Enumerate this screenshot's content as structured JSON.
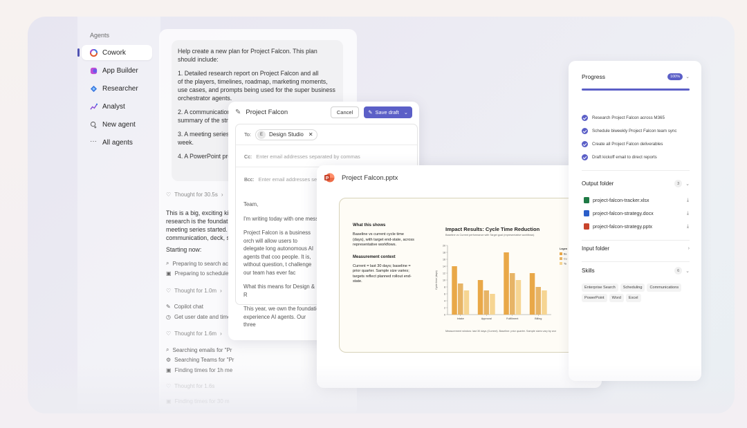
{
  "sidebar": {
    "title": "Agents",
    "items": [
      {
        "label": "Cowork",
        "icon": "copilot-icon"
      },
      {
        "label": "App Builder",
        "icon": "app-builder-icon"
      },
      {
        "label": "Researcher",
        "icon": "researcher-icon"
      },
      {
        "label": "Analyst",
        "icon": "analyst-icon"
      },
      {
        "label": "New agent",
        "icon": "new-agent-icon"
      },
      {
        "label": "All agents",
        "icon": "more-icon"
      }
    ]
  },
  "chat": {
    "prompt_paragraphs": [
      "Help create a new plan for Project Falcon. This plan should include:",
      "1. Detailed research report on Project Falcon and all\nof the players, timelines, roadmap, marketing moments, use cases, and prompts being used for the super business orchestrator agents.",
      "2. A communication\nsummary of the stra",
      "3. A meeting series\nweek.",
      "4. A PowerPoint pre"
    ],
    "thought_1": "Thought for 30.5s",
    "body_text": "This is a big, exciting kick research is the foundatio meeting series started. C communication, deck, st",
    "starting_now": "Starting now:",
    "step_1": "Preparing to search acro",
    "step_2": "Preparing to schedule m",
    "thought_2": "Thought for 1.0m",
    "copilot_chat": "Copilot chat",
    "get_date": "Get user date and time",
    "thought_3": "Thought for 1.6m",
    "search_emails": "Searching emails for \"Pr",
    "search_teams": "Searching Teams for \"Pr",
    "finding_times": "Finding times for 1h me",
    "thought_4": "Thought for 1.6s",
    "finding_times_2": "Finding times for 30 m"
  },
  "email": {
    "title": "Project Falcon",
    "cancel_label": "Cancel",
    "save_label": "Save draft",
    "to_label": "To:",
    "recipient": "Design Studio",
    "recipient_initial": "E",
    "cc_label": "Cc:",
    "cc_placeholder": "Enter email addresses separated by commas",
    "bcc_label": "Bcc:",
    "bcc_placeholder": "Enter email addresses separa",
    "greeting": "Team,",
    "p1": "I'm writing today with one mess",
    "p2": "Project Falcon is a business orch will allow users to delegate long autonomous AI agents that coo people. It is, without question, t challenge our team has ever fac",
    "p3": "What this means for Design & R",
    "p4": "This year, we own the foundatio experience AI agents. Our three"
  },
  "pptx": {
    "filename": "Project Falcon.pptx",
    "slide": {
      "left_h1": "What this shows",
      "left_p1": "Baseline vs current cycle time (days), with target end-state, across representative workflows.",
      "left_h2": "Measurement context",
      "left_p2": "Current = last 30 days; baseline = prior quarter. Sample size varies; targets reflect planned rollout end-state.",
      "footnote": "Measurement window: last 30 days (Current). Baseline: prior quarter. Sample sizes vary by wor"
    }
  },
  "chart_data": {
    "type": "bar",
    "title": "Impact Results: Cycle Time Reduction",
    "subtitle": "Baseline vs Current performance with Target goal (representative workflows)",
    "ylabel": "Cycle time (days)",
    "xlabel": "",
    "ylim": [
      0,
      20
    ],
    "yticks": [
      0,
      2,
      4,
      6,
      8,
      10,
      12,
      14,
      16,
      18,
      20
    ],
    "categories": [
      "Intake",
      "Approval",
      "Fulfillment",
      "Billing"
    ],
    "series": [
      {
        "name": "Ba",
        "values": [
          14,
          10,
          18,
          12
        ],
        "color": "#e9a848"
      },
      {
        "name": "Cu",
        "values": [
          9,
          7,
          12,
          8
        ],
        "color": "#e7b466"
      },
      {
        "name": "Ta",
        "values": [
          7,
          6,
          10,
          7
        ],
        "color": "#f6d592"
      }
    ],
    "legend_title": "Legen",
    "legend_position": "right",
    "grid": false
  },
  "progress": {
    "title": "Progress",
    "percent_label": "100%",
    "percent": 100,
    "steps": [
      "Research Project Falcon across M365",
      "Schedule biweekly Project Falcon team sync",
      "Create all Project Falcon deliverables",
      "Draft kickoff email to direct reports"
    ],
    "output_folder": {
      "label": "Output folder",
      "count": "3",
      "files": [
        {
          "name": "project-falcon-tracker.xlsx",
          "icon": "excel-icon",
          "color": "#1f7a45"
        },
        {
          "name": "project-falcon-strategy.docx",
          "icon": "word-icon",
          "color": "#2b5ec9"
        },
        {
          "name": "project-falcon-strategy.pptx",
          "icon": "powerpoint-icon",
          "color": "#c8442c"
        }
      ]
    },
    "input_folder": {
      "label": "Input folder"
    },
    "skills": {
      "label": "Skills",
      "count": "6",
      "tags": [
        "Enterprise Search",
        "Scheduling",
        "Communications",
        "PowerPoint",
        "Word",
        "Excel"
      ]
    }
  },
  "colors": {
    "accent": "#5b5fc7",
    "ppt_red": "#c8442c"
  }
}
